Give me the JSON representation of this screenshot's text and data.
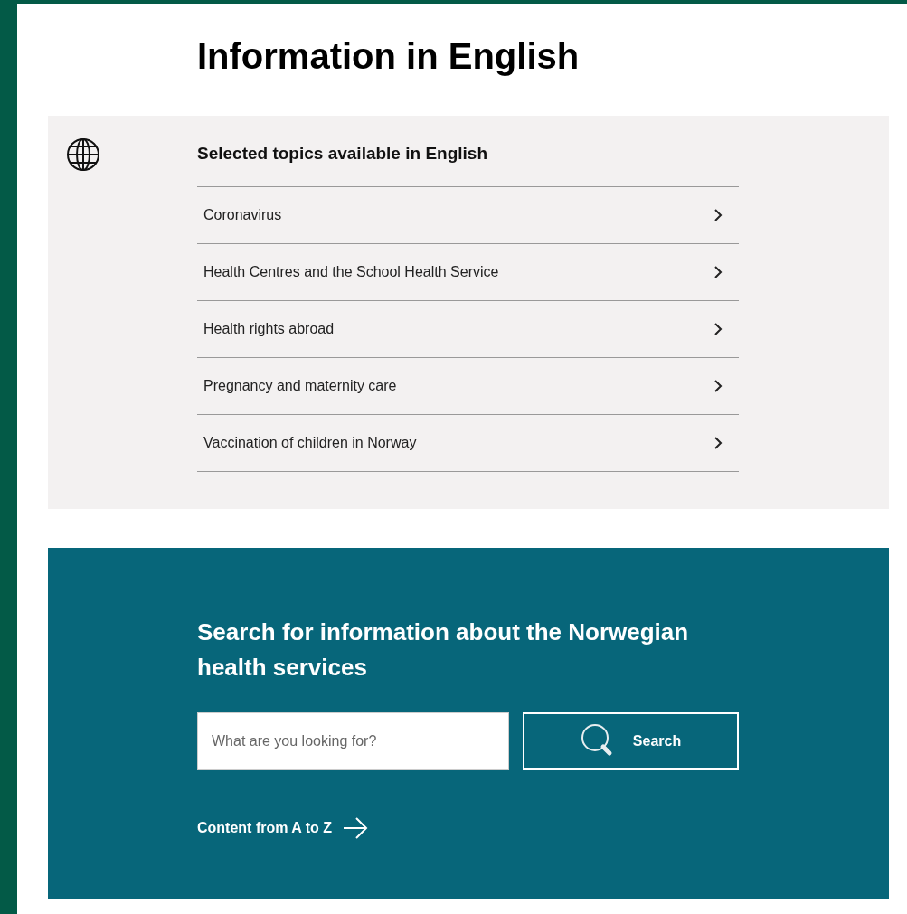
{
  "page_title": "Information in English",
  "topics": {
    "heading": "Selected topics available in English",
    "items": [
      {
        "label": "Coronavirus"
      },
      {
        "label": "Health Centres and the School Health Service"
      },
      {
        "label": "Health rights abroad"
      },
      {
        "label": "Pregnancy and maternity care"
      },
      {
        "label": "Vaccination of children in Norway"
      }
    ]
  },
  "search": {
    "heading": "Search for information about the Norwegian health services",
    "placeholder": "What are you looking for?",
    "button": "Search",
    "link": "Content from A to Z"
  }
}
